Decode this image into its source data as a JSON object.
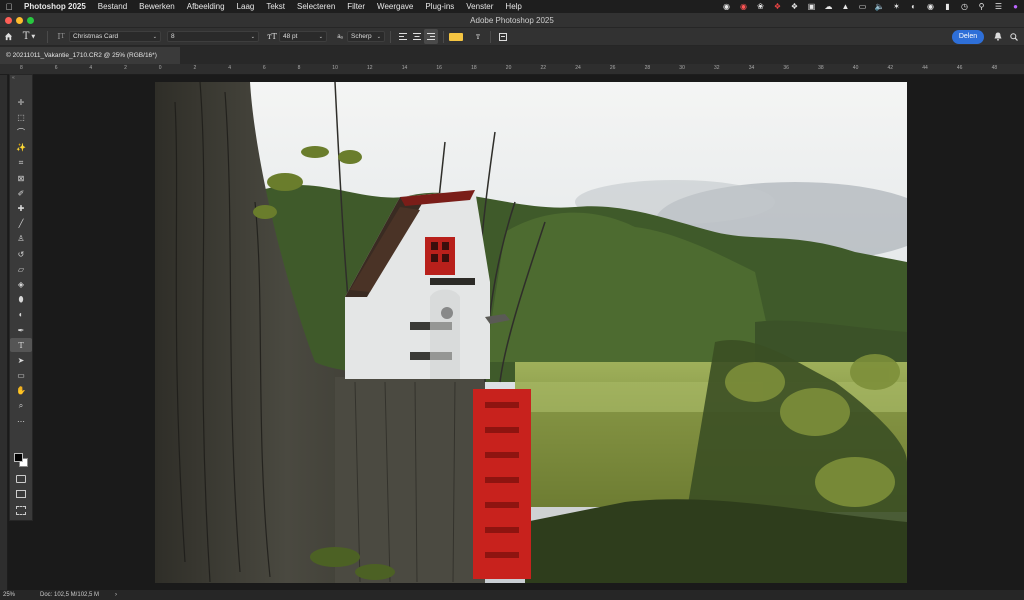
{
  "menubar": {
    "apple_icon": "apple-icon",
    "items": [
      "Photoshop 2025",
      "Bestand",
      "Bewerken",
      "Afbeelding",
      "Laag",
      "Tekst",
      "Selecteren",
      "Filter",
      "Weergave",
      "Plug-ins",
      "Venster",
      "Help"
    ],
    "status_icons": [
      "app-icon-1",
      "app-icon-2",
      "app-icon-3",
      "app-icon-4",
      "dropbox-icon",
      "app-icon-5",
      "drive-icon",
      "triangle-icon",
      "display-icon",
      "volume-icon",
      "bluetooth-icon",
      "wifi-icon",
      "user-icon",
      "battery-icon",
      "timemachine-icon",
      "search-icon",
      "control-center-icon",
      "siri-icon"
    ]
  },
  "window": {
    "title": "Adobe Photoshop 2025"
  },
  "options": {
    "home_icon": "home-icon",
    "tool_icon": "type-tool-icon",
    "font_family": "Christmas Card",
    "font_style": "8",
    "font_size": "48 pt",
    "aa_label": "aₐ",
    "anti_alias": "Scherp",
    "text_color": "#f5c542",
    "share_label": "Delen"
  },
  "document": {
    "tab_label": "© 20211011_Vakantie_1710.CR2 @ 25% (RGB/16*)"
  },
  "ruler": {
    "labels": [
      "8",
      "6",
      "4",
      "2",
      "0",
      "2",
      "4",
      "6",
      "8",
      "10",
      "12",
      "14",
      "16",
      "18",
      "20",
      "22",
      "24",
      "26",
      "28",
      "30",
      "32",
      "34",
      "36",
      "38",
      "40",
      "42",
      "44",
      "46",
      "48"
    ]
  },
  "tools": [
    "move-tool",
    "marquee-tool",
    "lasso-tool",
    "magic-wand-tool",
    "crop-tool",
    "frame-tool",
    "eyedropper-tool",
    "healing-brush-tool",
    "brush-tool",
    "clone-stamp-tool",
    "history-brush-tool",
    "eraser-tool",
    "paint-bucket-tool",
    "blur-tool",
    "dodge-tool",
    "pen-tool",
    "type-tool",
    "path-selection-tool",
    "rectangle-tool",
    "hand-tool",
    "zoom-tool",
    "more-tools"
  ],
  "status": {
    "zoom": "25%",
    "doc_info": "Doc: 102,5 M/102,5 M",
    "arrow": "›"
  },
  "colors": {
    "accent_blue": "#2e6fd8",
    "close_red": "#ff5f57",
    "min_yellow": "#febc2e",
    "max_green": "#28c840"
  }
}
